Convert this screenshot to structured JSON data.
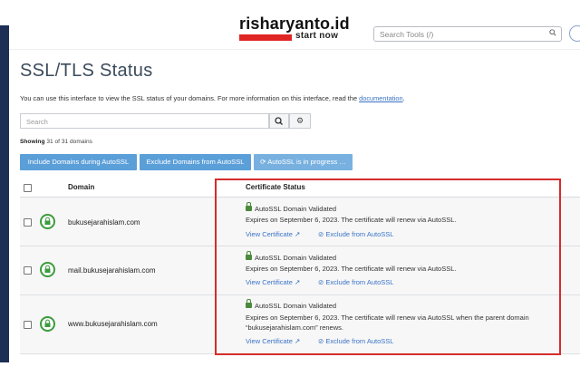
{
  "header": {
    "logo_text": "risharyanto.id",
    "logo_tagline": "start now",
    "search_tools_placeholder": "Search Tools (/)"
  },
  "page": {
    "title": "SSL/TLS Status",
    "description": "You can use this interface to view the SSL status of your domains. For more information on this interface, read the",
    "doc_link": "documentation",
    "description_end": ".",
    "search_placeholder": "Search",
    "showing_prefix": "Showing",
    "showing_count": "31 of 31 domains"
  },
  "actions": {
    "include": "Include Domains during AutoSSL",
    "exclude": "Exclude Domains from AutoSSL",
    "progress": "AutoSSL is in progress …"
  },
  "table": {
    "col_domain": "Domain",
    "col_status": "Certificate Status",
    "rows": [
      {
        "domain": "bukusejarahislam.com",
        "status": "AutoSSL Domain Validated",
        "expires": "Expires on September 6, 2023. The certificate will renew via AutoSSL.",
        "view": "View Certificate",
        "exclude": "Exclude from AutoSSL"
      },
      {
        "domain": "mail.bukusejarahislam.com",
        "status": "AutoSSL Domain Validated",
        "expires": "Expires on September 6, 2023. The certificate will renew via AutoSSL.",
        "view": "View Certificate",
        "exclude": "Exclude from AutoSSL"
      },
      {
        "domain": "www.bukusejarahislam.com",
        "status": "AutoSSL Domain Validated",
        "expires": "Expires on September 6, 2023. The certificate will renew via AutoSSL when the parent domain “bukusejarahislam.com” renews.",
        "view": "View Certificate",
        "exclude": "Exclude from AutoSSL"
      }
    ]
  },
  "colors": {
    "sidebar": "#1d2f55",
    "button": "#5b9fd9",
    "link": "#3a73c6",
    "lock_green": "#3d9b3d",
    "highlight_red": "#d62c2c",
    "logo_red": "#e02525"
  }
}
